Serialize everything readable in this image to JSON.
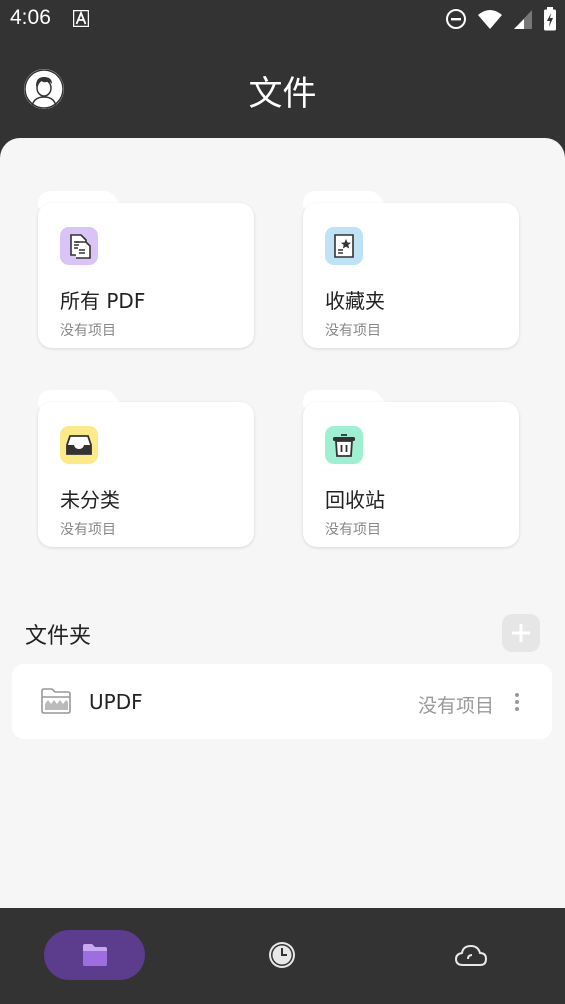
{
  "status_bar": {
    "time": "4:06",
    "icons": [
      "a-notification-icon",
      "do-not-disturb-icon",
      "wifi-icon",
      "signal-icon",
      "battery-charging-icon"
    ]
  },
  "header": {
    "title": "文件",
    "avatar_icon": "user-avatar-icon"
  },
  "categories": [
    {
      "label": "所有 PDF",
      "sub": "没有项目",
      "icon": "all-pdf-icon",
      "color": "#d9c4f5"
    },
    {
      "label": "收藏夹",
      "sub": "没有项目",
      "icon": "favorites-icon",
      "color": "#bfe2f7"
    },
    {
      "label": "未分类",
      "sub": "没有项目",
      "icon": "inbox-icon",
      "color": "#fbe98a"
    },
    {
      "label": "回收站",
      "sub": "没有项目",
      "icon": "trash-icon",
      "color": "#9ff0d2"
    }
  ],
  "folders": {
    "title": "文件夹",
    "add_icon": "plus-icon",
    "items": [
      {
        "name": "UPDF",
        "count": "没有项目",
        "icon": "folder-icon",
        "menu_icon": "more-vertical-icon"
      }
    ]
  },
  "bottom_nav": {
    "items": [
      {
        "icon": "folder-icon",
        "active": true
      },
      {
        "icon": "clock-icon",
        "active": false
      },
      {
        "icon": "cloud-icon",
        "active": false
      }
    ],
    "active_color": "#5c3c8c"
  }
}
